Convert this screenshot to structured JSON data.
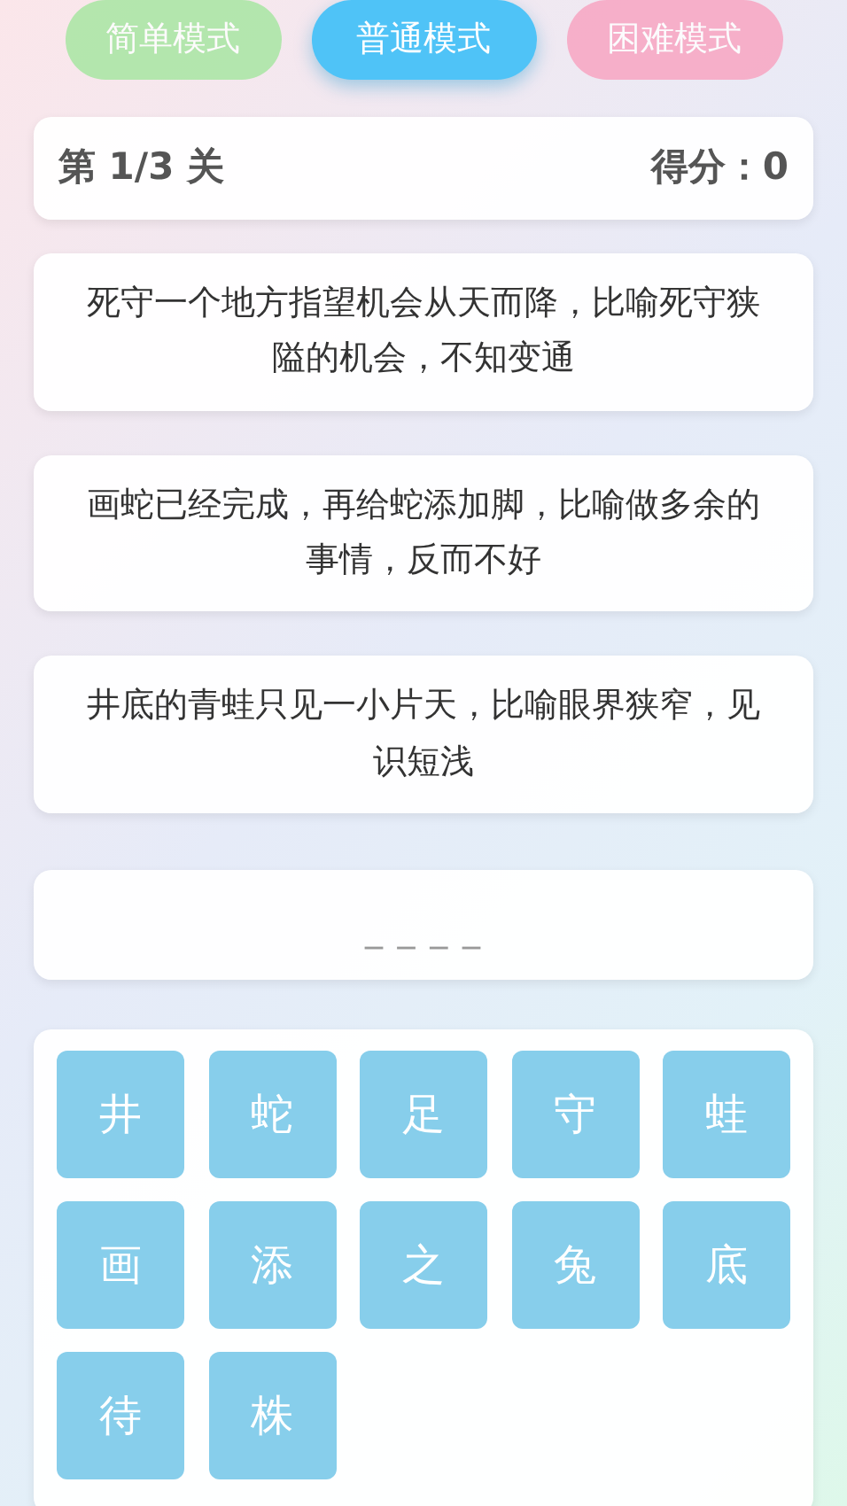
{
  "modes": [
    {
      "label": "简单模式",
      "selected": false,
      "color": "#a8e6a3"
    },
    {
      "label": "普通模式",
      "selected": true,
      "color": "#4fc3f7"
    },
    {
      "label": "困难模式",
      "selected": false,
      "color": "#f8a5c2"
    }
  ],
  "header": {
    "level": "第 1/3 关",
    "score": "得分：0"
  },
  "clues": [
    {
      "text": "死守一个地方指望机会从天而降，比喻死守狭隘的机会，不知变通"
    },
    {
      "text": "画蛇已经完成，再给蛇添加脚，比喻做多余的事情，反而不好"
    },
    {
      "text": "井底的青蛙只见一小片天，比喻眼界狭窄，见识短浅"
    }
  ],
  "answer": {
    "placeholder": "_ _ _ _"
  },
  "tiles": [
    "井",
    "蛇",
    "足",
    "守",
    "蛙",
    "画",
    "添",
    "之",
    "兔",
    "底",
    "待",
    "株"
  ]
}
